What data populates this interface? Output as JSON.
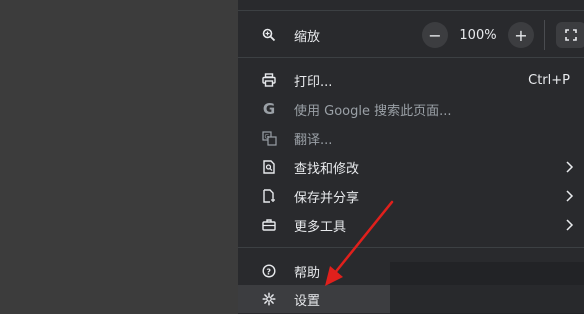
{
  "menu": {
    "zoom": {
      "label": "缩放",
      "minus": "−",
      "value": "100%",
      "plus": "+"
    },
    "items": [
      {
        "label": "打印...",
        "shortcut": "Ctrl+P"
      },
      {
        "label": "使用 Google 搜索此页面..."
      },
      {
        "label": "翻译..."
      },
      {
        "label": "查找和修改"
      },
      {
        "label": "保存并分享"
      },
      {
        "label": "更多工具"
      },
      {
        "label": "帮助"
      },
      {
        "label": "设置"
      }
    ]
  },
  "colors": {
    "menu_bg": "#292a2d",
    "text": "#e8eaed",
    "disabled_text": "#9aa0a6",
    "arrow": "#e0201c"
  }
}
